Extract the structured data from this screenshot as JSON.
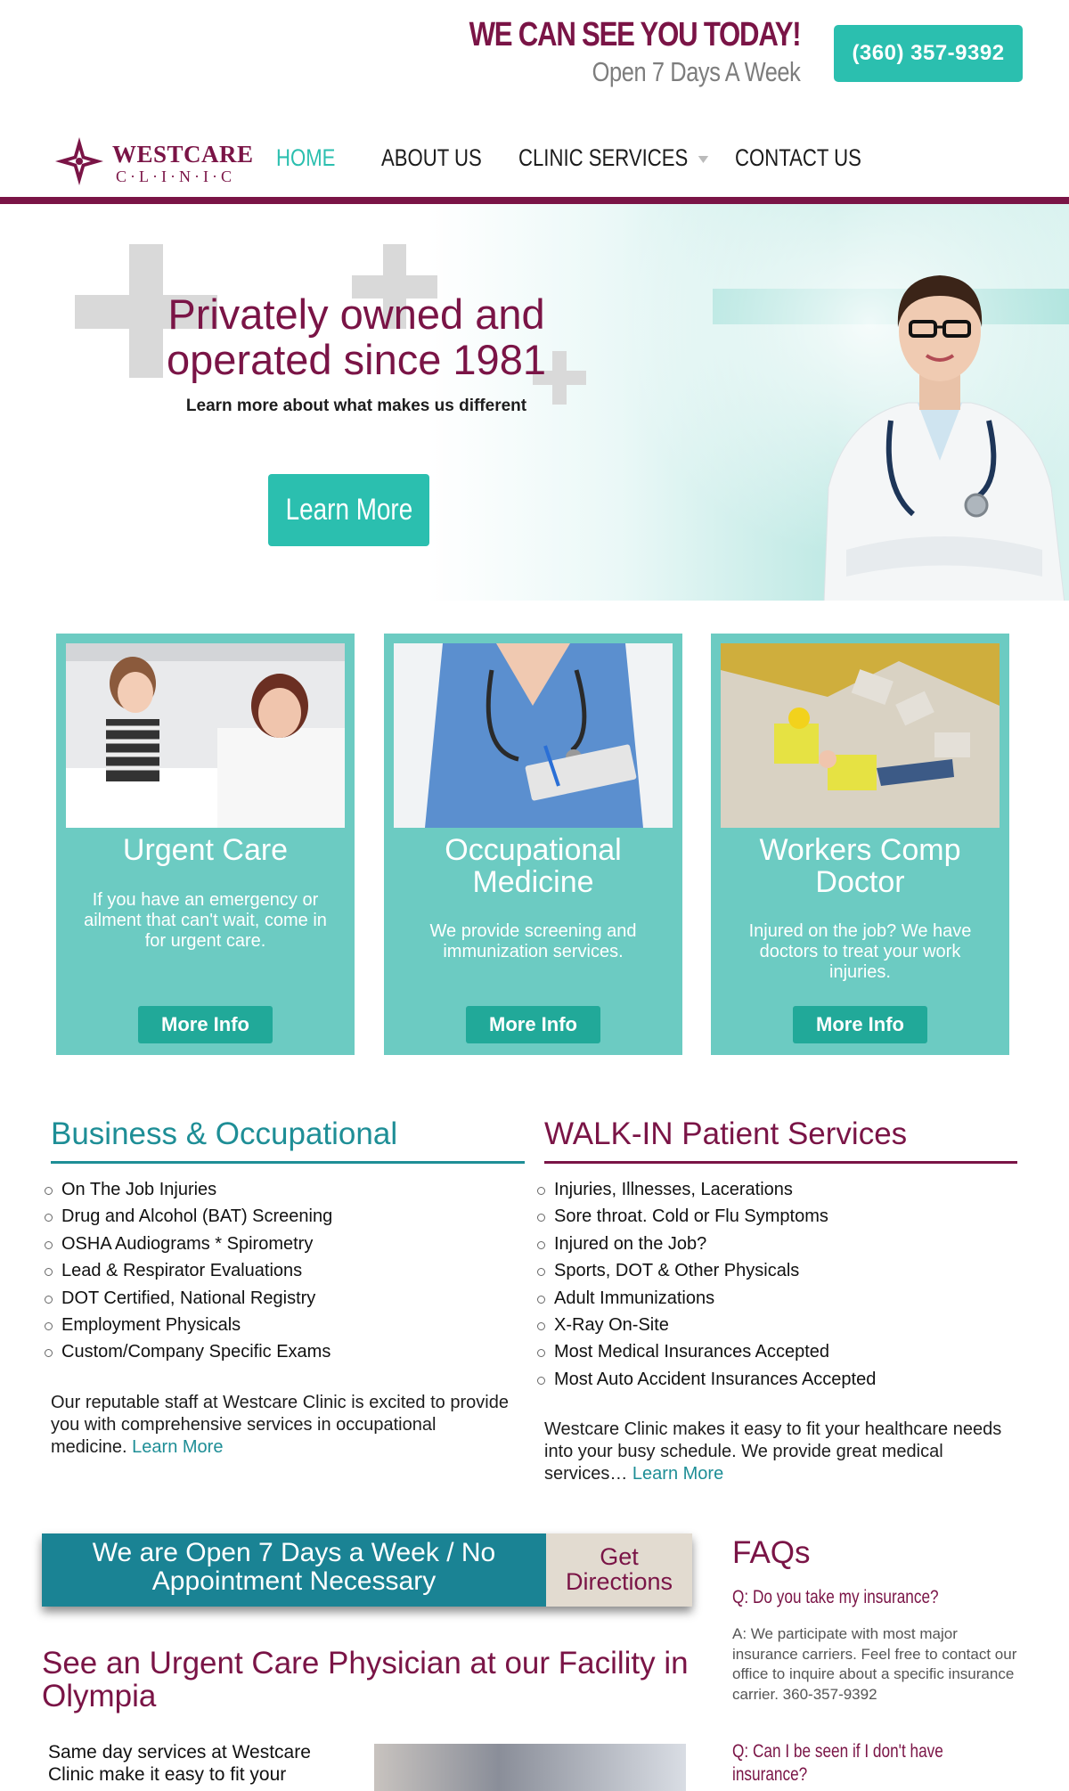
{
  "header": {
    "headline": "WE CAN SEE YOU TODAY!",
    "subline": "Open 7 Days A Week",
    "phone": "(360) 357-9392"
  },
  "logo": {
    "word1": "WESTCARE",
    "word2": "C·L·I·N·I·C"
  },
  "nav": {
    "home": "HOME",
    "about": "ABOUT US",
    "services": "CLINIC SERVICES",
    "contact": "CONTACT US"
  },
  "hero": {
    "title": "Privately owned and operated since 1981",
    "subtitle": "Learn more about what makes us different",
    "button": "Learn More"
  },
  "cards": [
    {
      "title": "Urgent Care",
      "text": "If you have an emergency or ailment that can't wait, come in for urgent care.",
      "button": "More Info"
    },
    {
      "title": "Occupational Medicine",
      "text": "We provide screening and immunization services.",
      "button": "More Info"
    },
    {
      "title": "Workers Comp Doctor",
      "text": "Injured on the job? We have doctors to treat your work injuries.",
      "button": "More Info"
    }
  ],
  "business": {
    "title": "Business & Occupational",
    "items": [
      "On The Job Injuries",
      "Drug and Alcohol (BAT) Screening",
      "OSHA Audiograms * Spirometry",
      "Lead & Respirator Evaluations",
      "DOT Certified, National Registry",
      "Employment Physicals",
      "Custom/Company Specific Exams"
    ],
    "para": "Our reputable staff at Westcare Clinic is excited to provide you with comprehensive services in occupational medicine.",
    "link": "Learn More"
  },
  "walkin": {
    "title": "WALK-IN Patient Services",
    "items": [
      "Injuries, Illnesses, Lacerations",
      "Sore throat. Cold or Flu Symptoms",
      "Injured on the Job?",
      "Sports, DOT & Other Physicals",
      "Adult Immunizations",
      "X-Ray On-Site",
      "Most Medical Insurances Accepted",
      "Most Auto Accident Insurances Accepted"
    ],
    "para": "Westcare Clinic makes it easy to fit your healthcare needs into your busy schedule. We provide great medical services…",
    "link": "Learn More"
  },
  "banner": {
    "text": "We are Open 7 Days a Week / No Appointment Necessary",
    "directions": "Get Directions"
  },
  "urgent": {
    "title": "See an Urgent Care Physician at our Facility in Olympia",
    "para": "Same day services at Westcare Clinic make it easy to fit your"
  },
  "faq": {
    "title": "FAQs",
    "q1": "Q: Do you take my insurance?",
    "a1": "A: We participate with most major insurance carriers. Feel free to contact our office to inquire about a specific insurance carrier. 360-357-9392",
    "q2": "Q: Can I be seen if I don't have insurance?"
  },
  "colors": {
    "brand": "#7a1446",
    "accent": "#2bbfaf",
    "card": "#6ccbc2",
    "banner": "#1a8394"
  }
}
